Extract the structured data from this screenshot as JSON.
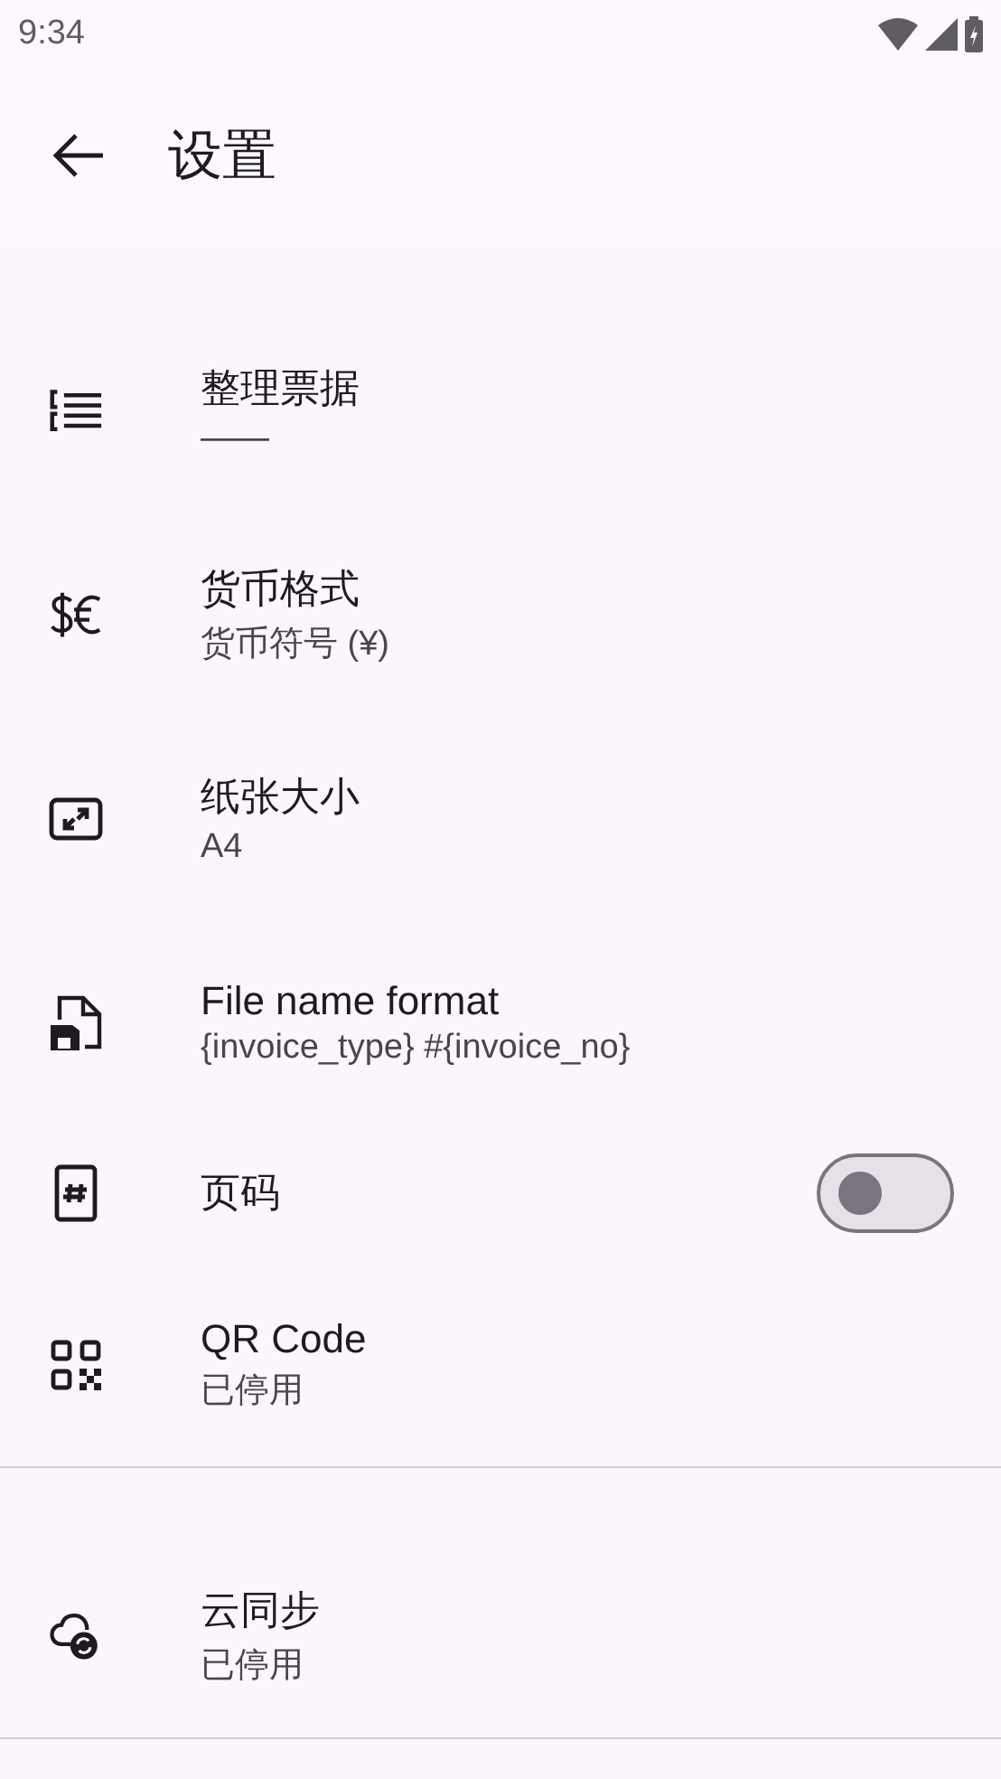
{
  "status_bar": {
    "time": "9:34"
  },
  "app_bar": {
    "title": "设置"
  },
  "sections": [
    {
      "items": [
        {
          "kind": "item",
          "title": "整理票据",
          "subtitle": "——"
        },
        {
          "kind": "item",
          "title": "货币格式",
          "subtitle": "货币符号 (¥)"
        },
        {
          "kind": "item",
          "title": "纸张大小",
          "subtitle": "A4"
        },
        {
          "kind": "item",
          "title": "File name format",
          "subtitle": "{invoice_type} #{invoice_no}"
        },
        {
          "kind": "toggle",
          "title": "页码",
          "on": false
        },
        {
          "kind": "item",
          "title": "QR Code",
          "subtitle": "已停用"
        }
      ]
    },
    {
      "items": [
        {
          "kind": "item",
          "title": "云同步",
          "subtitle": "已停用"
        }
      ]
    }
  ]
}
